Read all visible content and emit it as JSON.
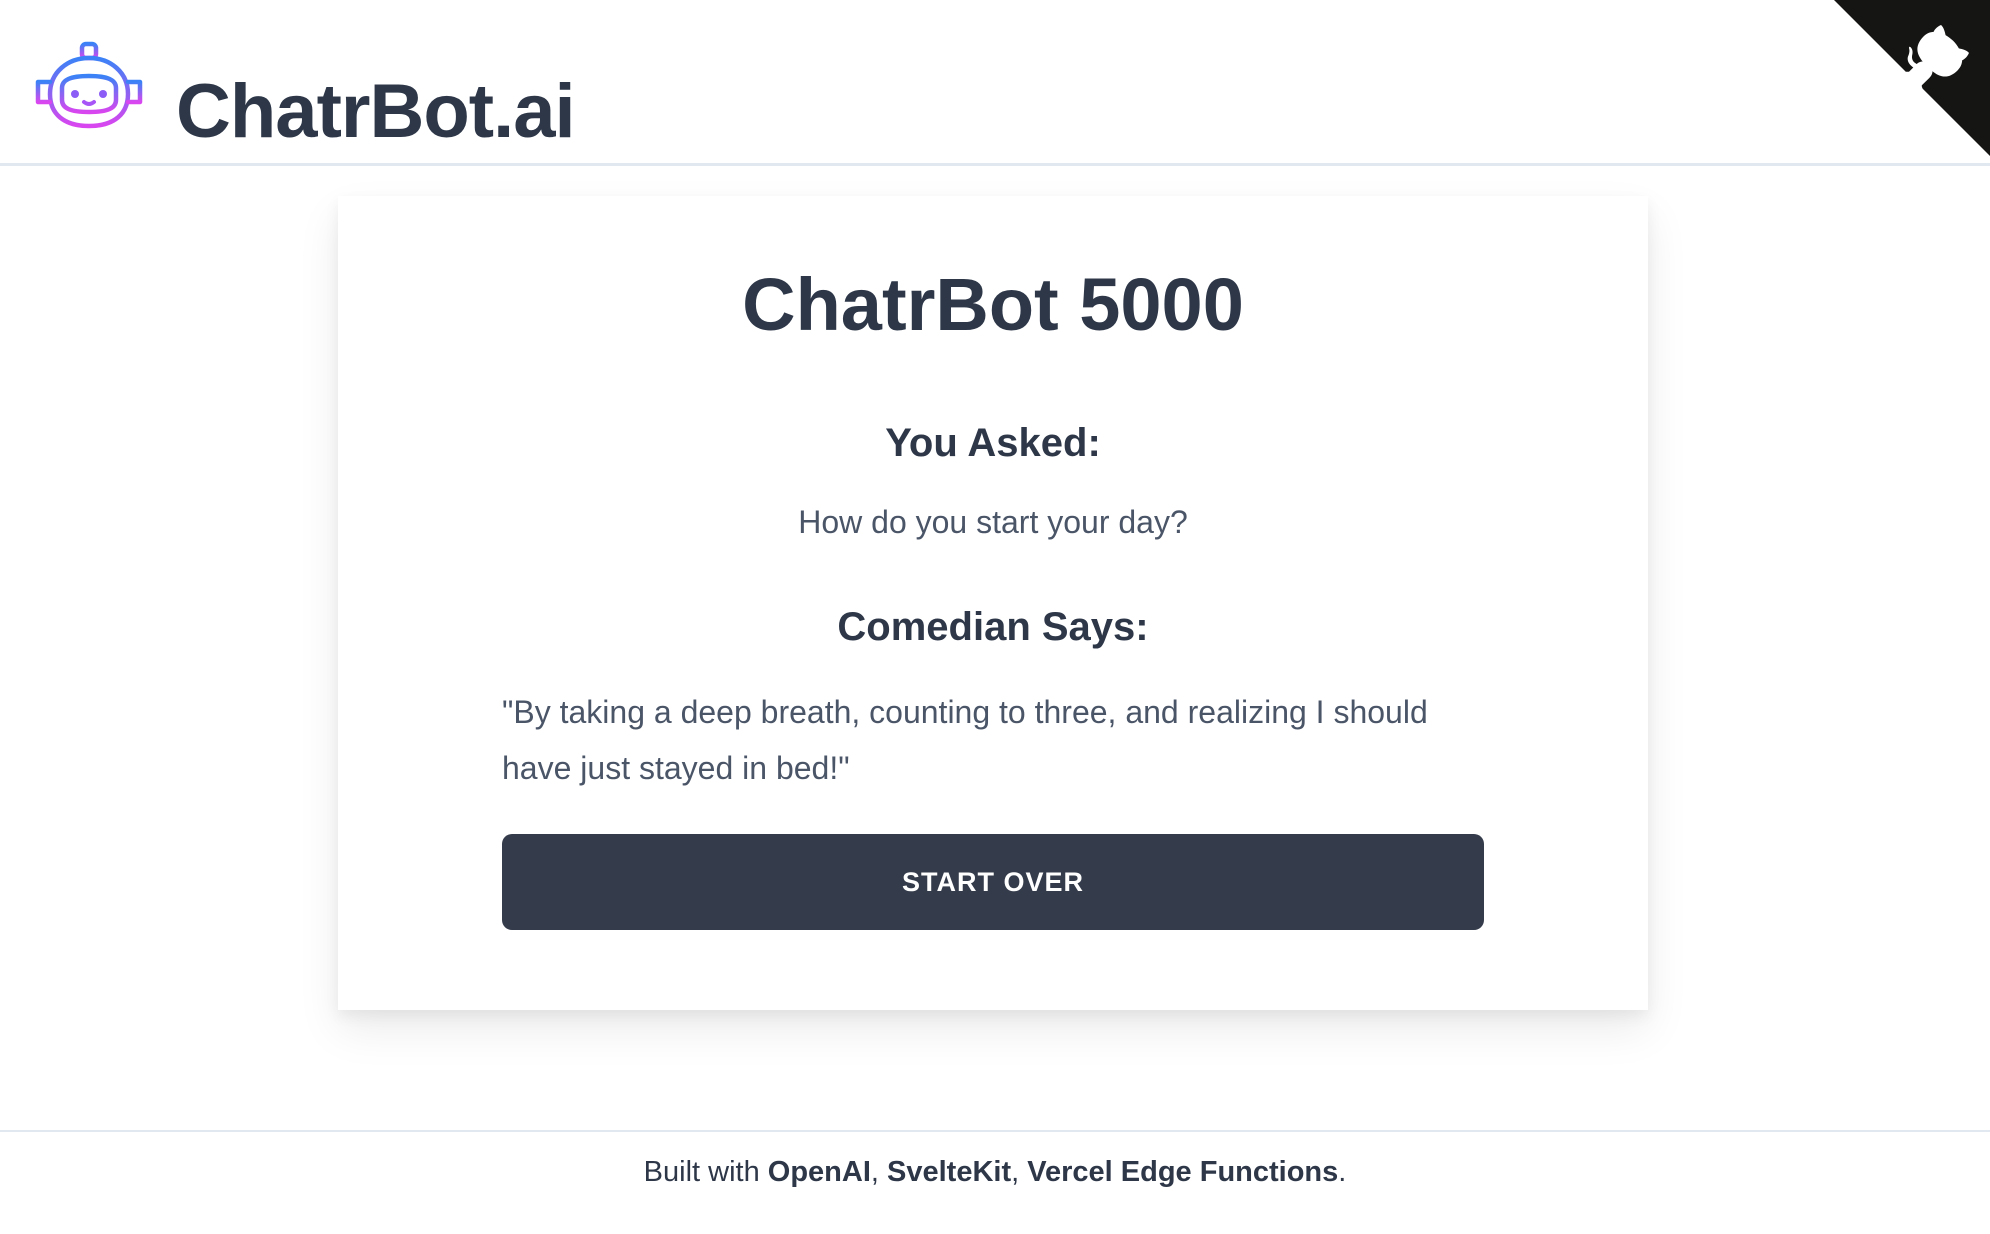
{
  "header": {
    "brand": "ChatrBot.ai",
    "logo_icon": "robot-head-icon",
    "corner_icon": "github-octocat-icon"
  },
  "card": {
    "title": "ChatrBot 5000",
    "asked_heading": "You Asked:",
    "question": "How do you start your day?",
    "says_heading": "Comedian Says:",
    "answer": "\"By taking a deep breath, counting to three, and realizing I should have just stayed in bed!\"",
    "button_label": "START OVER"
  },
  "footer": {
    "prefix": "Built with ",
    "links": [
      "OpenAI",
      "SvelteKit",
      "Vercel Edge Functions"
    ],
    "sep1": ", ",
    "sep2": ", ",
    "suffix": "."
  },
  "colors": {
    "text_dark": "#2d3748",
    "text_muted": "#4a5568",
    "button_bg": "#343b4a",
    "logo_gradient_start": "#3b82f6",
    "logo_gradient_end": "#d946ef",
    "divider": "#e2e8f0"
  }
}
